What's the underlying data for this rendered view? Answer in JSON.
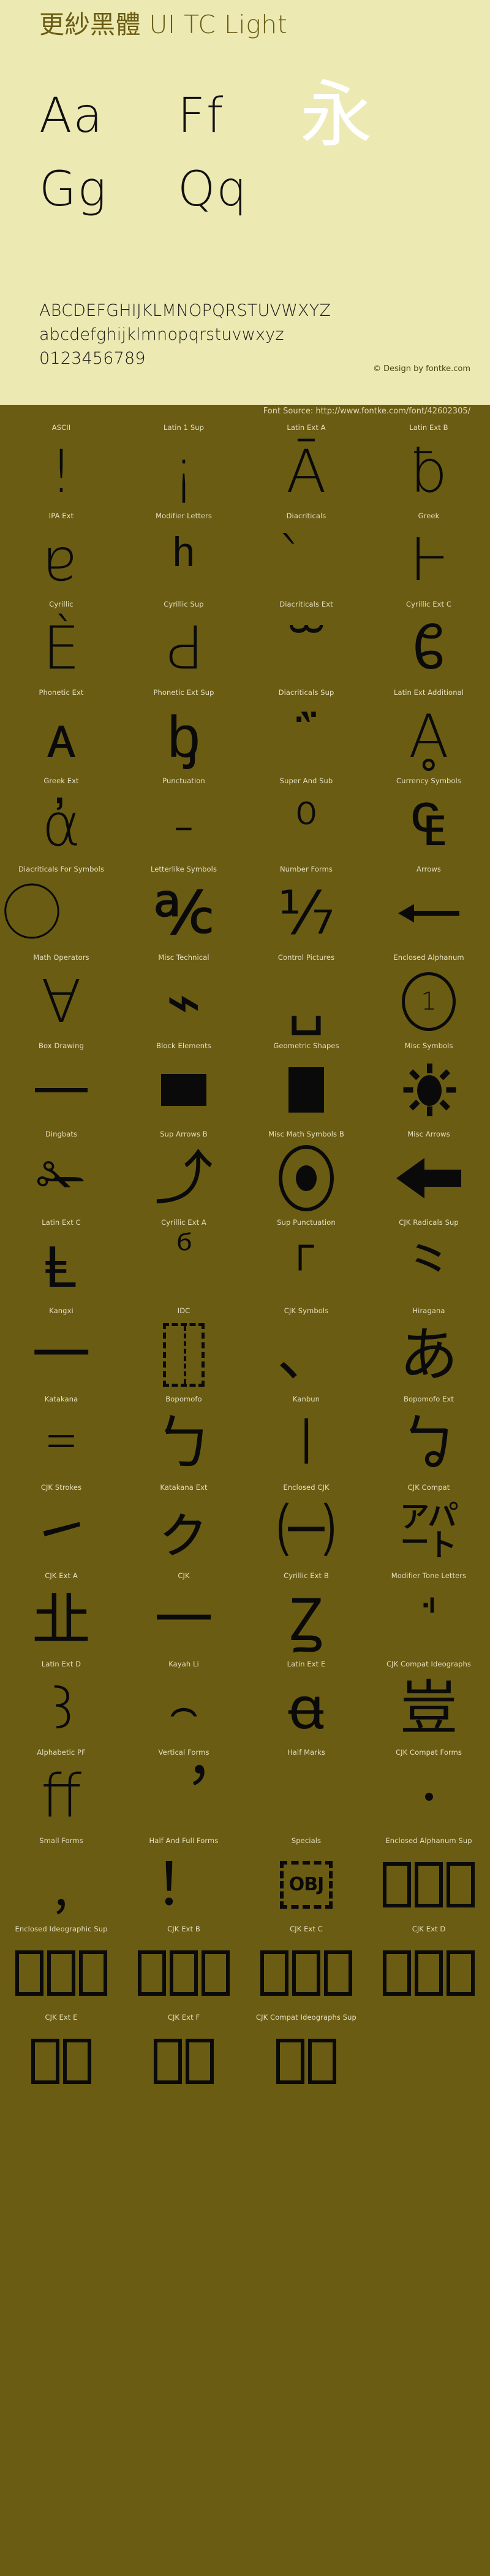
{
  "header": {
    "title": "更紗黑體 UI TC Light",
    "sample_big": [
      {
        "text": "Aa",
        "kind": "latin"
      },
      {
        "text": "Ff",
        "kind": "latin"
      },
      {
        "text": "永",
        "kind": "cjk"
      },
      {
        "text": "Gg",
        "kind": "latin"
      },
      {
        "text": "Qq",
        "kind": "latin"
      }
    ],
    "uppercase": "ABCDEFGHIJKLMNOPQRSTUVWXYZ",
    "lowercase": "abcdefghijklmnopqrstuvwxyz",
    "digits": "0123456789",
    "credit": "© Design by fontke.com",
    "source": "Font Source: http://www.fontke.com/font/42602305/",
    "colors": {
      "panel_bg": "#ece9b2",
      "band_bg": "#6b5c13",
      "title_fg": "#6b5c13",
      "glyph_fg": "#0a0a0a",
      "cjk_fg": "#ffffff",
      "label_fg": "#e4dfc0"
    }
  },
  "grid": {
    "columns": 4,
    "cells": [
      {
        "label": "ASCII",
        "glyph": "!",
        "render": "text",
        "size": "huge"
      },
      {
        "label": "Latin 1 Sup",
        "glyph": "¡",
        "render": "text",
        "size": "huge"
      },
      {
        "label": "Latin Ext A",
        "glyph": "Ā",
        "render": "text",
        "size": "huge"
      },
      {
        "label": "Latin Ext B",
        "glyph": "ƀ",
        "render": "text",
        "size": "huge"
      },
      {
        "label": "IPA Ext",
        "glyph": "ɐ",
        "render": "text",
        "size": "huge"
      },
      {
        "label": "Modifier Letters",
        "glyph": "ʰ",
        "render": "text",
        "size": "huge"
      },
      {
        "label": "Diacriticals",
        "glyph": "̀",
        "render": "text",
        "size": "huge"
      },
      {
        "label": "Greek",
        "glyph": "Ͱ",
        "render": "text",
        "size": "huge"
      },
      {
        "label": "Cyrillic",
        "glyph": "Ѐ",
        "render": "text",
        "size": "huge"
      },
      {
        "label": "Cyrillic Sup",
        "glyph": "Ԁ",
        "render": "text",
        "size": "huge"
      },
      {
        "label": "Diacriticals Ext",
        "glyph": "ᷓ",
        "render": "text",
        "size": "huge"
      },
      {
        "label": "Cyrillic Ext C",
        "glyph": "ᲀ",
        "render": "text",
        "size": "huge"
      },
      {
        "label": "Phonetic Ext",
        "glyph": "ᴀ",
        "render": "text",
        "size": "huge"
      },
      {
        "label": "Phonetic Ext Sup",
        "glyph": "ᶀ",
        "render": "text",
        "size": "huge"
      },
      {
        "label": "Diacriticals Sup",
        "glyph": "᷀",
        "render": "text",
        "size": "huge"
      },
      {
        "label": "Latin Ext Additional",
        "glyph": "Ḁ",
        "render": "text",
        "size": "huge"
      },
      {
        "label": "Greek Ext",
        "glyph": "ἀ",
        "render": "text",
        "size": "huge"
      },
      {
        "label": "Punctuation",
        "glyph": "‐",
        "render": "text",
        "size": "huge"
      },
      {
        "label": "Super And Sub",
        "glyph": "⁰",
        "render": "text",
        "size": "huge"
      },
      {
        "label": "Currency Symbols",
        "glyph": "₠",
        "render": "text",
        "size": "huge"
      },
      {
        "label": "Diacriticals For Symbols",
        "glyph": "⃝",
        "render": "text",
        "size": "huge"
      },
      {
        "label": "Letterlike Symbols",
        "glyph": "℀",
        "render": "text",
        "size": "huge"
      },
      {
        "label": "Number Forms",
        "glyph": "⅐",
        "render": "text",
        "size": "huge"
      },
      {
        "label": "Arrows",
        "glyph": "arrow-left",
        "render": "arrow-left"
      },
      {
        "label": "Math Operators",
        "glyph": "∀",
        "render": "text",
        "size": "huge"
      },
      {
        "label": "Misc Technical",
        "glyph": "⌁",
        "render": "text",
        "size": "huge"
      },
      {
        "label": "Control Pictures",
        "glyph": "␣",
        "render": "text",
        "size": "huge"
      },
      {
        "label": "Enclosed Alphanum",
        "glyph": "①",
        "render": "circled-1"
      },
      {
        "label": "Box Drawing",
        "glyph": "─",
        "render": "hbar"
      },
      {
        "label": "Block Elements",
        "glyph": "▀",
        "render": "block-wide"
      },
      {
        "label": "Geometric Shapes",
        "glyph": "■",
        "render": "block-tall"
      },
      {
        "label": "Misc Symbols",
        "glyph": "☀",
        "render": "sun"
      },
      {
        "label": "Dingbats",
        "glyph": "✁",
        "render": "text",
        "size": "huge"
      },
      {
        "label": "Sup Arrows B",
        "glyph": "⤴",
        "render": "text",
        "size": "huge"
      },
      {
        "label": "Misc Math Symbols B",
        "glyph": "⦿",
        "render": "bullseye"
      },
      {
        "label": "Misc Arrows",
        "glyph": "⬅",
        "render": "arrow-left-fat"
      },
      {
        "label": "Latin Ext C",
        "glyph": "Ⱡ",
        "render": "text",
        "size": "huge"
      },
      {
        "label": "Cyrillic Ext A",
        "glyph": "ⷠ",
        "render": "text",
        "size": "huge"
      },
      {
        "label": "Sup Punctuation",
        "glyph": "⸀",
        "render": "text",
        "size": "huge"
      },
      {
        "label": "CJK Radicals Sup",
        "glyph": "⺀",
        "render": "text",
        "size": "huge"
      },
      {
        "label": "Kangxi",
        "glyph": "⼀",
        "render": "text",
        "size": "huge"
      },
      {
        "label": "IDC",
        "glyph": "⿰",
        "render": "dashbox"
      },
      {
        "label": "CJK Symbols",
        "glyph": "、",
        "render": "text",
        "size": "huge"
      },
      {
        "label": "Hiragana",
        "glyph": "あ",
        "render": "text",
        "size": "huge"
      },
      {
        "label": "Katakana",
        "glyph": "゠",
        "render": "text",
        "size": "huge"
      },
      {
        "label": "Bopomofo",
        "glyph": "ㄅ",
        "render": "text",
        "size": "huge"
      },
      {
        "label": "Kanbun",
        "glyph": "㆐",
        "render": "text",
        "size": "huge"
      },
      {
        "label": "Bopomofo Ext",
        "glyph": "ㆠ",
        "render": "text",
        "size": "huge"
      },
      {
        "label": "CJK Strokes",
        "glyph": "㇀",
        "render": "text",
        "size": "huge"
      },
      {
        "label": "Katakana Ext",
        "glyph": "ㇰ",
        "render": "text",
        "size": "huge"
      },
      {
        "label": "Enclosed CJK",
        "glyph": "㈠",
        "render": "text",
        "size": "huge"
      },
      {
        "label": "CJK Compat",
        "glyph": "㌀",
        "render": "text",
        "size": "huge"
      },
      {
        "label": "CJK Ext A",
        "glyph": "㐀",
        "render": "text",
        "size": "huge"
      },
      {
        "label": "CJK",
        "glyph": "一",
        "render": "text",
        "size": "huge"
      },
      {
        "label": "Cyrillic Ext B",
        "glyph": "Ꙁ",
        "render": "text",
        "size": "huge"
      },
      {
        "label": "Modifier Tone Letters",
        "glyph": "ꜗ",
        "render": "text",
        "size": "huge"
      },
      {
        "label": "Latin Ext D",
        "glyph": "Ꜣ",
        "render": "text",
        "size": "huge"
      },
      {
        "label": "Kayah Li",
        "glyph": "꤮",
        "render": "text",
        "size": "huge"
      },
      {
        "label": "Latin Ext E",
        "glyph": "ꬰ",
        "render": "text",
        "size": "huge"
      },
      {
        "label": "CJK Compat Ideographs",
        "glyph": "豈",
        "render": "text",
        "size": "huge"
      },
      {
        "label": "Alphabetic PF",
        "glyph": "ﬀ",
        "render": "text",
        "size": "huge"
      },
      {
        "label": "Vertical Forms",
        "glyph": "︐",
        "render": "text",
        "size": "huge"
      },
      {
        "label": "Half Marks",
        "glyph": "︀",
        "render": "text",
        "size": "huge"
      },
      {
        "label": "CJK Compat Forms",
        "glyph": "﹅",
        "render": "dot"
      },
      {
        "label": "Small Forms",
        "glyph": "﹐",
        "render": "text",
        "size": "huge"
      },
      {
        "label": "Half And Full Forms",
        "glyph": "！",
        "render": "text",
        "size": "huge"
      },
      {
        "label": "Specials",
        "glyph": "OBJ",
        "render": "objbox"
      },
      {
        "label": "Enclosed Alphanum Sup",
        "glyph": "🄀",
        "render": "tofu-run",
        "count": 3
      },
      {
        "label": "Enclosed Ideographic Sup",
        "glyph": "🈀",
        "render": "tofu-run",
        "count": 3
      },
      {
        "label": "CJK Ext B",
        "glyph": "𠀀",
        "render": "tofu-run",
        "count": 3
      },
      {
        "label": "CJK Ext C",
        "glyph": "𪜀",
        "render": "tofu-run",
        "count": 3
      },
      {
        "label": "CJK Ext D",
        "glyph": "𫝀",
        "render": "tofu-run",
        "count": 3
      },
      {
        "label": "CJK Ext E",
        "glyph": "𫠠",
        "render": "tofu-run",
        "count": 2
      },
      {
        "label": "CJK Ext F",
        "glyph": "𬺡",
        "render": "tofu-run",
        "count": 2
      },
      {
        "label": "CJK Compat Ideographs Sup",
        "glyph": "丽",
        "render": "tofu-run",
        "count": 2
      },
      {
        "label": "",
        "glyph": "",
        "render": "empty"
      }
    ]
  }
}
